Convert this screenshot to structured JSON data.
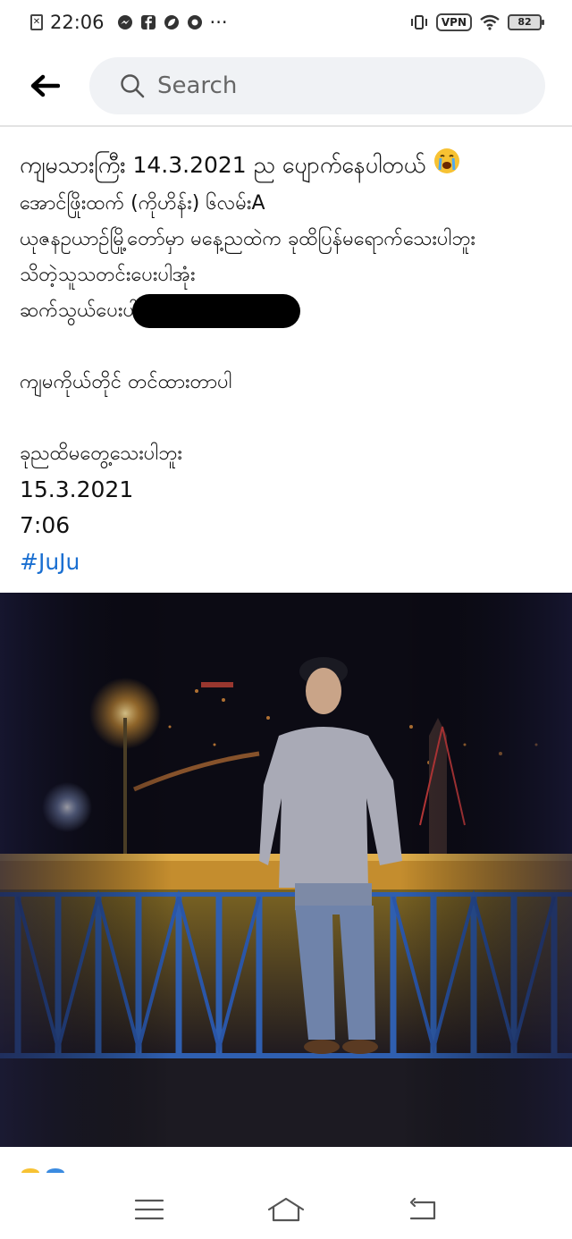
{
  "status_bar": {
    "time": "22:06",
    "more": "···",
    "vpn": "VPN",
    "battery": "82"
  },
  "search": {
    "placeholder": "Search"
  },
  "post": {
    "line1_text": "ကျမသားကြီး 14.3.2021 ည ပျောက်နေပါတယ်",
    "line2": "အောင်ဖြိုးထက် (ကိုဟိန်း) ၆လမ်းA",
    "line3": "ယုဇနဥယာဥ်မြို့တော်မှာ မနေ့ညထဲက ခုထိပြန်မရောက်သေးပါဘူး",
    "line4": "သိတဲ့သူသတင်းပေးပါအုံး",
    "line5": "ဆက်သွယ်ပေးပါ",
    "line6": "ကျမကိုယ်တိုင် တင်ထားတာပါ",
    "line7": "ခုညထိမတွေ့သေးပါဘူး",
    "date": "15.3.2021",
    "time": "7:06",
    "hashtag": "#JuJu"
  },
  "colors": {
    "hashtag": "#1a6fd1",
    "search_bg": "#f0f2f5"
  },
  "icons": {
    "back": "back-arrow-icon",
    "search": "search-icon",
    "emoji": "crying-face-emoji-icon",
    "nav_menu": "menu-icon",
    "nav_home": "home-icon",
    "nav_back": "back-icon"
  }
}
